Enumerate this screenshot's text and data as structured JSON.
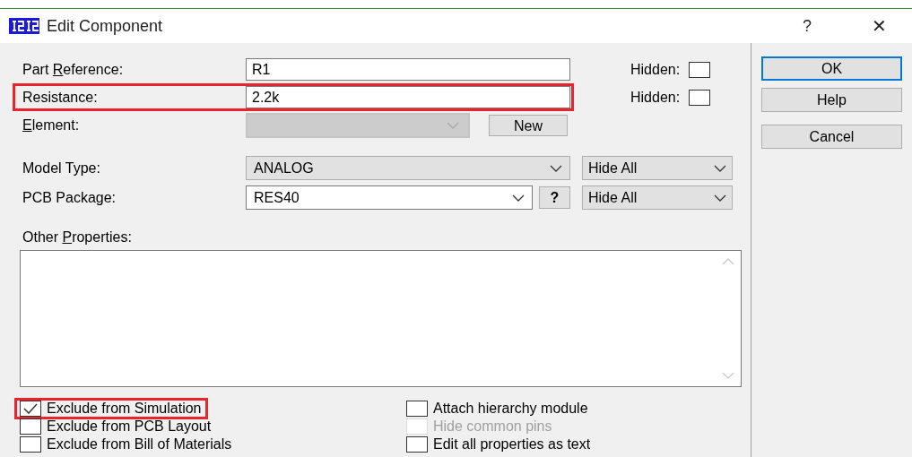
{
  "window": {
    "title": "Edit Component",
    "help_glyph": "?",
    "close_glyph": "✕"
  },
  "fields": [
    {
      "kind": "text",
      "label": {
        "before": "Part ",
        "key": "R",
        "after": "eference:"
      },
      "value": "R1",
      "hidden_label": "Hidden:",
      "hidden": false,
      "highlighted": false
    },
    {
      "kind": "text",
      "label": {
        "after": "Resistance:"
      },
      "value": "2.2k",
      "hidden_label": "Hidden:",
      "hidden": false,
      "highlighted": true
    },
    {
      "kind": "element",
      "label": {
        "key": "E",
        "after": "lement:"
      },
      "disabled": true,
      "button": "New"
    },
    {
      "kind": "combo",
      "label": {
        "after": "Model Type:"
      },
      "value": "ANALOG",
      "visibility": "Hide All"
    },
    {
      "kind": "package",
      "label": {
        "after": "PCB Package:"
      },
      "value": "RES40",
      "help": "?",
      "visibility": "Hide All"
    }
  ],
  "other_properties": {
    "label": {
      "before": "Other ",
      "key": "P",
      "after": "roperties:"
    }
  },
  "options": [
    {
      "label": "Exclude from Simulation",
      "checked": true,
      "disabled": false,
      "highlighted": true
    },
    {
      "label": "Attach hierarchy module",
      "checked": false,
      "disabled": false,
      "highlighted": false
    },
    {
      "label": "Exclude from PCB Layout",
      "checked": false,
      "disabled": false,
      "highlighted": false
    },
    {
      "label": "Hide common pins",
      "checked": false,
      "disabled": true,
      "highlighted": false
    },
    {
      "label": "Exclude from Bill of Materials",
      "checked": false,
      "disabled": false,
      "highlighted": false
    },
    {
      "label": "Edit all properties as text",
      "checked": false,
      "disabled": false,
      "highlighted": false
    }
  ],
  "buttons": [
    {
      "label": "OK",
      "default": true
    },
    {
      "label": "Help",
      "default": false
    },
    {
      "label": "Cancel",
      "default": false
    }
  ]
}
